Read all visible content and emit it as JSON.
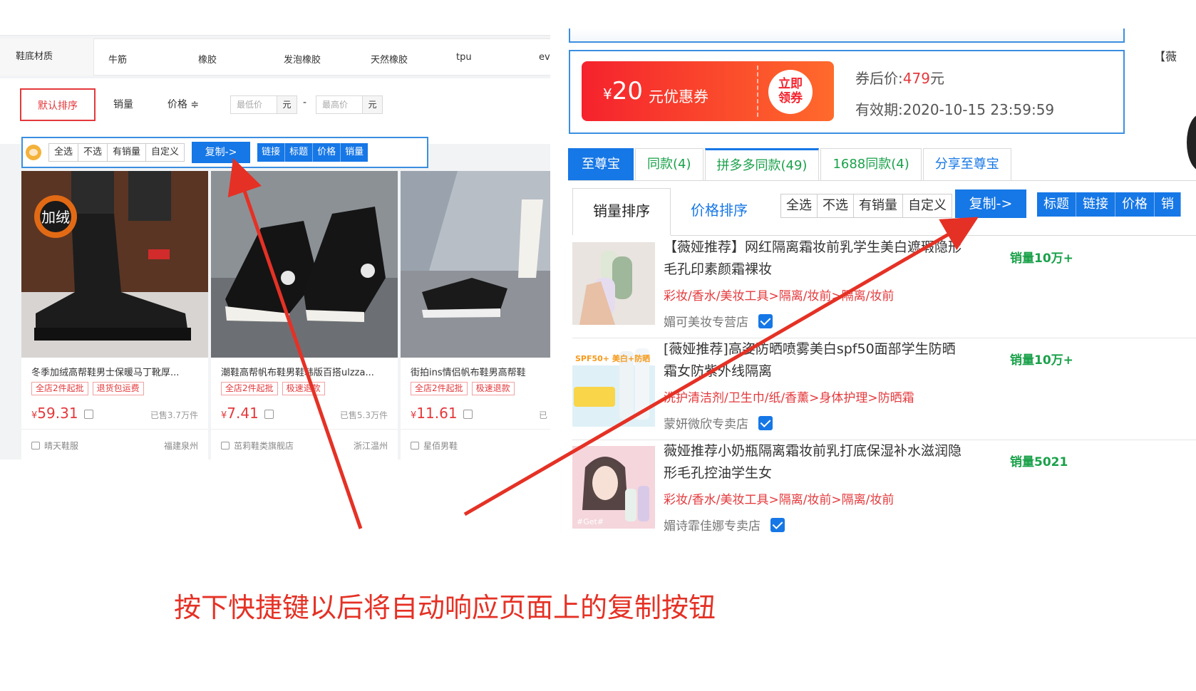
{
  "left": {
    "filter": {
      "label": "鞋底材质",
      "options": [
        "牛筋",
        "橡胶",
        "发泡橡胶",
        "天然橡胶",
        "tpu",
        "ev"
      ]
    },
    "sort": {
      "default": "默认排序",
      "sales": "销量",
      "price": "价格 ≑",
      "min_placeholder": "最低价",
      "max_placeholder": "最高价",
      "unit": "元",
      "dash": "-"
    },
    "toolbar": {
      "select": [
        "全选",
        "不选",
        "有销量",
        "自定义"
      ],
      "copy": "复制->",
      "fields": [
        "链接",
        "标题",
        "价格",
        "销量"
      ]
    },
    "products": [
      {
        "title": "冬季加绒高帮鞋男士保暖马丁靴厚...",
        "tags": [
          "全店2件起批",
          "退货包运费"
        ],
        "price_symbol": "¥",
        "price": "59.31",
        "sold": "已售3.7万件",
        "shop": "晴天鞋服",
        "location": "福建泉州",
        "badge": "加绒"
      },
      {
        "title": "潮鞋高帮帆布鞋男鞋韩版百搭ulzza...",
        "tags": [
          "全店2件起批",
          "极速退款"
        ],
        "price_symbol": "¥",
        "price": "7.41",
        "sold": "已售5.3万件",
        "shop": "茁莉鞋类旗舰店",
        "location": "浙江温州"
      },
      {
        "title": "街拍ins情侣帆布鞋男高帮鞋",
        "tags": [
          "全店2件起批",
          "极速退款"
        ],
        "price_symbol": "¥",
        "price": "11.61",
        "sold": "已",
        "shop": "星佰男鞋",
        "location": ""
      }
    ]
  },
  "right": {
    "coupon": {
      "symbol": "¥",
      "amount": "20",
      "text": "元优惠券",
      "claim_line1": "立即",
      "claim_line2": "领券",
      "after_label": "券后价:",
      "after_value": "479",
      "after_unit": "元",
      "validity": "有效期:2020-10-15 23:59:59"
    },
    "tabs": [
      "至尊宝",
      "同款(4)",
      "拼多多同款(49)",
      "1688同款(4)",
      "分享至尊宝"
    ],
    "subtabs": {
      "sales": "销量排序",
      "price": "价格排序"
    },
    "toolbar": {
      "select": [
        "全选",
        "不选",
        "有销量",
        "自定义"
      ],
      "copy": "复制->",
      "fields": [
        "标题",
        "链接",
        "价格",
        "销"
      ]
    },
    "items": [
      {
        "title": "【薇娅推荐】网红隔离霜妆前乳学生美白遮瑕隐形毛孔印素颜霜裸妆",
        "category": "彩妆/香水/美妆工具>隔离/妆前>隔离/妆前",
        "shop": "媚可美妆专营店",
        "sales": "销量10万+"
      },
      {
        "title": "[薇娅推荐]高姿防晒喷雾美白spf50面部学生防晒霜女防紫外线隔离",
        "category": "洗护清洁剂/卫生巾/纸/香薰>身体护理>防晒霜",
        "shop": "蒙妍微欣专卖店",
        "sales": "销量10万+",
        "thumb_text": "SPF50+ 美白+防晒"
      },
      {
        "title": "薇娅推荐小奶瓶隔离霜妆前乳打底保湿补水滋润隐形毛孔控油学生女",
        "category": "彩妆/香水/美妆工具>隔离/妆前>隔离/妆前",
        "shop": "媚诗霏佳娜专卖店",
        "sales": "销量5021",
        "thumb_text": "#Get#"
      }
    ],
    "side_peek": "【薇"
  },
  "caption": "按下快捷键以后将自动响应页面上的复制按钮",
  "colors": {
    "accent_blue": "#1677e6",
    "red": "#e4393c",
    "green": "#1aa14a",
    "arrow": "#e53125"
  }
}
